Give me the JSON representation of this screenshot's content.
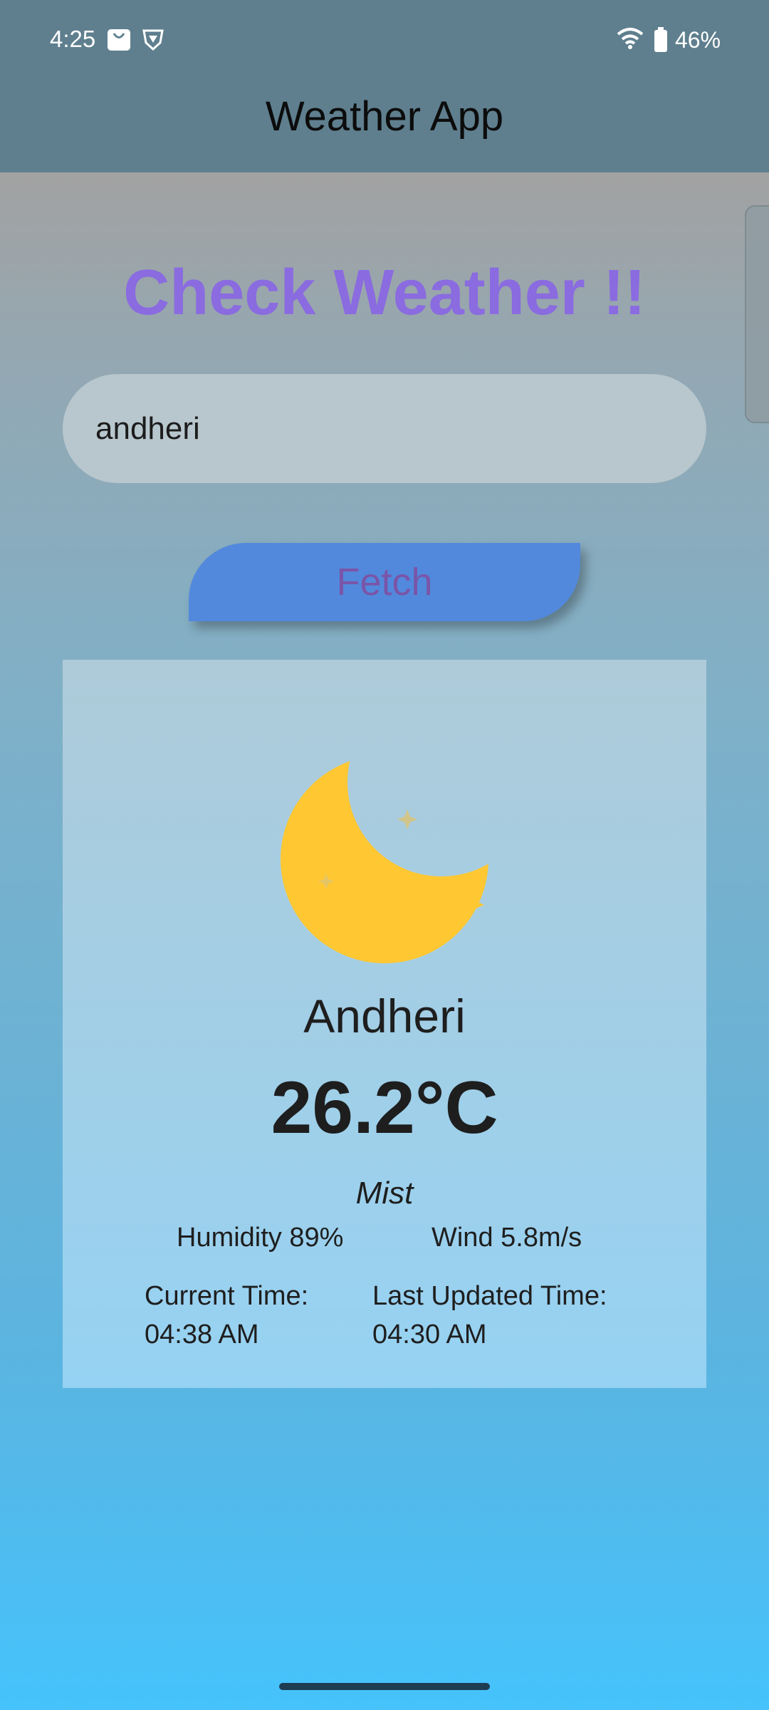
{
  "status_bar": {
    "time": "4:25",
    "battery_percent": "46%",
    "icons": [
      "bag-icon",
      "shield-icon",
      "wifi-icon",
      "battery-icon"
    ]
  },
  "app_bar": {
    "title": "Weather App"
  },
  "main": {
    "heading": "Check Weather !!",
    "search": {
      "value": "andheri",
      "placeholder": ""
    },
    "fetch_label": "Fetch"
  },
  "weather": {
    "icon": "moon-icon",
    "city": "Andheri",
    "temperature": "26.2°C",
    "description": "Mist",
    "humidity": "Humidity 89%",
    "wind": "Wind 5.8m/s",
    "current_time_label": "Current Time:",
    "current_time": "04:38 AM",
    "last_updated_label": "Last Updated Time:",
    "last_updated": "04:30 AM"
  },
  "colors": {
    "app_bar": "#5f7f8e",
    "heading": "#8a6be0",
    "button": "#5289dc",
    "button_text": "#7a55a8",
    "moon": "#ffc833"
  }
}
